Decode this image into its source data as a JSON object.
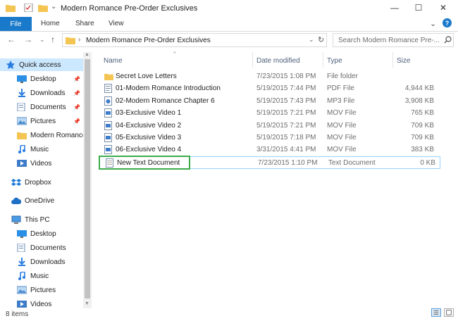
{
  "window": {
    "title": "Modern Romance Pre-Order Exclusives",
    "minimize_glyph": "—",
    "maximize_glyph": "☐",
    "close_glyph": "✕"
  },
  "ribbon": {
    "tabs": [
      "File",
      "Home",
      "Share",
      "View"
    ],
    "expand_glyph": "⌄",
    "help_glyph": "?"
  },
  "address_bar": {
    "back_glyph": "←",
    "forward_glyph": "→",
    "recent_glyph": "⌄",
    "up_glyph": "↑",
    "separator_glyph": "›",
    "path": "Modern Romance Pre-Order Exclusives",
    "dropdown_glyph": "⌄",
    "refresh_glyph": "↻",
    "search_placeholder": "Search Modern Romance Pre-..."
  },
  "nav_pane": {
    "items": [
      {
        "label": "Quick access",
        "icon": "star-icon",
        "pinned": false,
        "selected": true
      },
      {
        "label": "Desktop",
        "icon": "desktop-icon",
        "pinned": true
      },
      {
        "label": "Downloads",
        "icon": "download-icon",
        "pinned": true
      },
      {
        "label": "Documents",
        "icon": "documents-icon",
        "pinned": true
      },
      {
        "label": "Pictures",
        "icon": "pictures-icon",
        "pinned": true
      },
      {
        "label": "Modern Romance",
        "icon": "folder-icon",
        "pinned": false
      },
      {
        "label": "Music",
        "icon": "music-icon",
        "pinned": false
      },
      {
        "label": "Videos",
        "icon": "videos-icon",
        "pinned": false
      },
      {
        "label": "Dropbox",
        "icon": "dropbox-icon",
        "pinned": false
      },
      {
        "label": "OneDrive",
        "icon": "cloud-icon",
        "pinned": false
      },
      {
        "label": "This PC",
        "icon": "computer-icon",
        "pinned": false
      },
      {
        "label": "Desktop",
        "icon": "desktop-icon",
        "pinned": false
      },
      {
        "label": "Documents",
        "icon": "documents-icon",
        "pinned": false
      },
      {
        "label": "Downloads",
        "icon": "download-icon",
        "pinned": false
      },
      {
        "label": "Music",
        "icon": "music-icon",
        "pinned": false
      },
      {
        "label": "Pictures",
        "icon": "pictures-icon",
        "pinned": false
      },
      {
        "label": "Videos",
        "icon": "videos-icon",
        "pinned": false
      }
    ],
    "pin_glyph": "📌"
  },
  "file_list": {
    "columns": [
      "Name",
      "Date modified",
      "Type",
      "Size"
    ],
    "sort_glyph": "^",
    "rows": [
      {
        "name": "Secret Love Letters",
        "date": "7/23/2015 1:08 PM",
        "type": "File folder",
        "size": "",
        "icon": "folder-icon"
      },
      {
        "name": "01-Modern Romance Introduction",
        "date": "5/19/2015 7:44 PM",
        "type": "PDF File",
        "size": "4,944 KB",
        "icon": "pdf-icon"
      },
      {
        "name": "02-Modern Romance Chapter 6",
        "date": "5/19/2015 7:43 PM",
        "type": "MP3 File",
        "size": "3,908 KB",
        "icon": "audio-file-icon"
      },
      {
        "name": "03-Exclusive Video 1",
        "date": "5/19/2015 7:21 PM",
        "type": "MOV File",
        "size": "765 KB",
        "icon": "video-file-icon"
      },
      {
        "name": "04-Exclusive Video 2",
        "date": "5/19/2015 7:21 PM",
        "type": "MOV File",
        "size": "709 KB",
        "icon": "video-file-icon"
      },
      {
        "name": "05-Exclusive Video 3",
        "date": "5/19/2015 7:18 PM",
        "type": "MOV File",
        "size": "709 KB",
        "icon": "video-file-icon"
      },
      {
        "name": "06-Exclusive Video 4",
        "date": "3/31/2015 4:41 PM",
        "type": "MOV File",
        "size": "383 KB",
        "icon": "video-file-icon"
      },
      {
        "name": "New Text Document",
        "date": "7/23/2015 1:10 PM",
        "type": "Text Document",
        "size": "0 KB",
        "icon": "text-file-icon",
        "selected": true
      }
    ]
  },
  "status_bar": {
    "item_count": "8 items"
  },
  "colors": {
    "accent": "#1979ca",
    "selection": "#cce8ff",
    "highlight_box": "#3cab4a",
    "folder": "#f4c552"
  }
}
